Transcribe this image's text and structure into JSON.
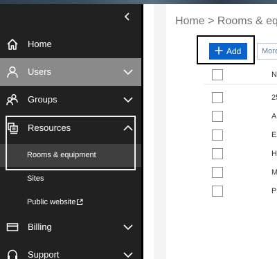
{
  "sidebar": {
    "items": [
      {
        "label": "Home",
        "icon": "home-icon"
      },
      {
        "label": "Users",
        "icon": "user-icon"
      },
      {
        "label": "Groups",
        "icon": "groups-icon"
      },
      {
        "label": "Resources",
        "icon": "resources-icon"
      },
      {
        "label": "Billing",
        "icon": "billing-icon"
      },
      {
        "label": "Support",
        "icon": "support-icon"
      }
    ],
    "resources_sub": [
      {
        "label": "Rooms & equipment"
      },
      {
        "label": "Sites"
      },
      {
        "label": "Public website"
      }
    ]
  },
  "main": {
    "breadcrumb": "Home > Rooms & eq",
    "add_label": "Add",
    "more_label": "More",
    "table": {
      "header": "Na",
      "rows": [
        "25",
        "A",
        "Ex",
        "H",
        "M",
        "Pa"
      ]
    }
  },
  "colors": {
    "sidebar_bg": "#212121",
    "users_highlight": "#8a8a8a",
    "active_sub_bg": "#3f3f3f",
    "accent": "#0a63c9"
  }
}
